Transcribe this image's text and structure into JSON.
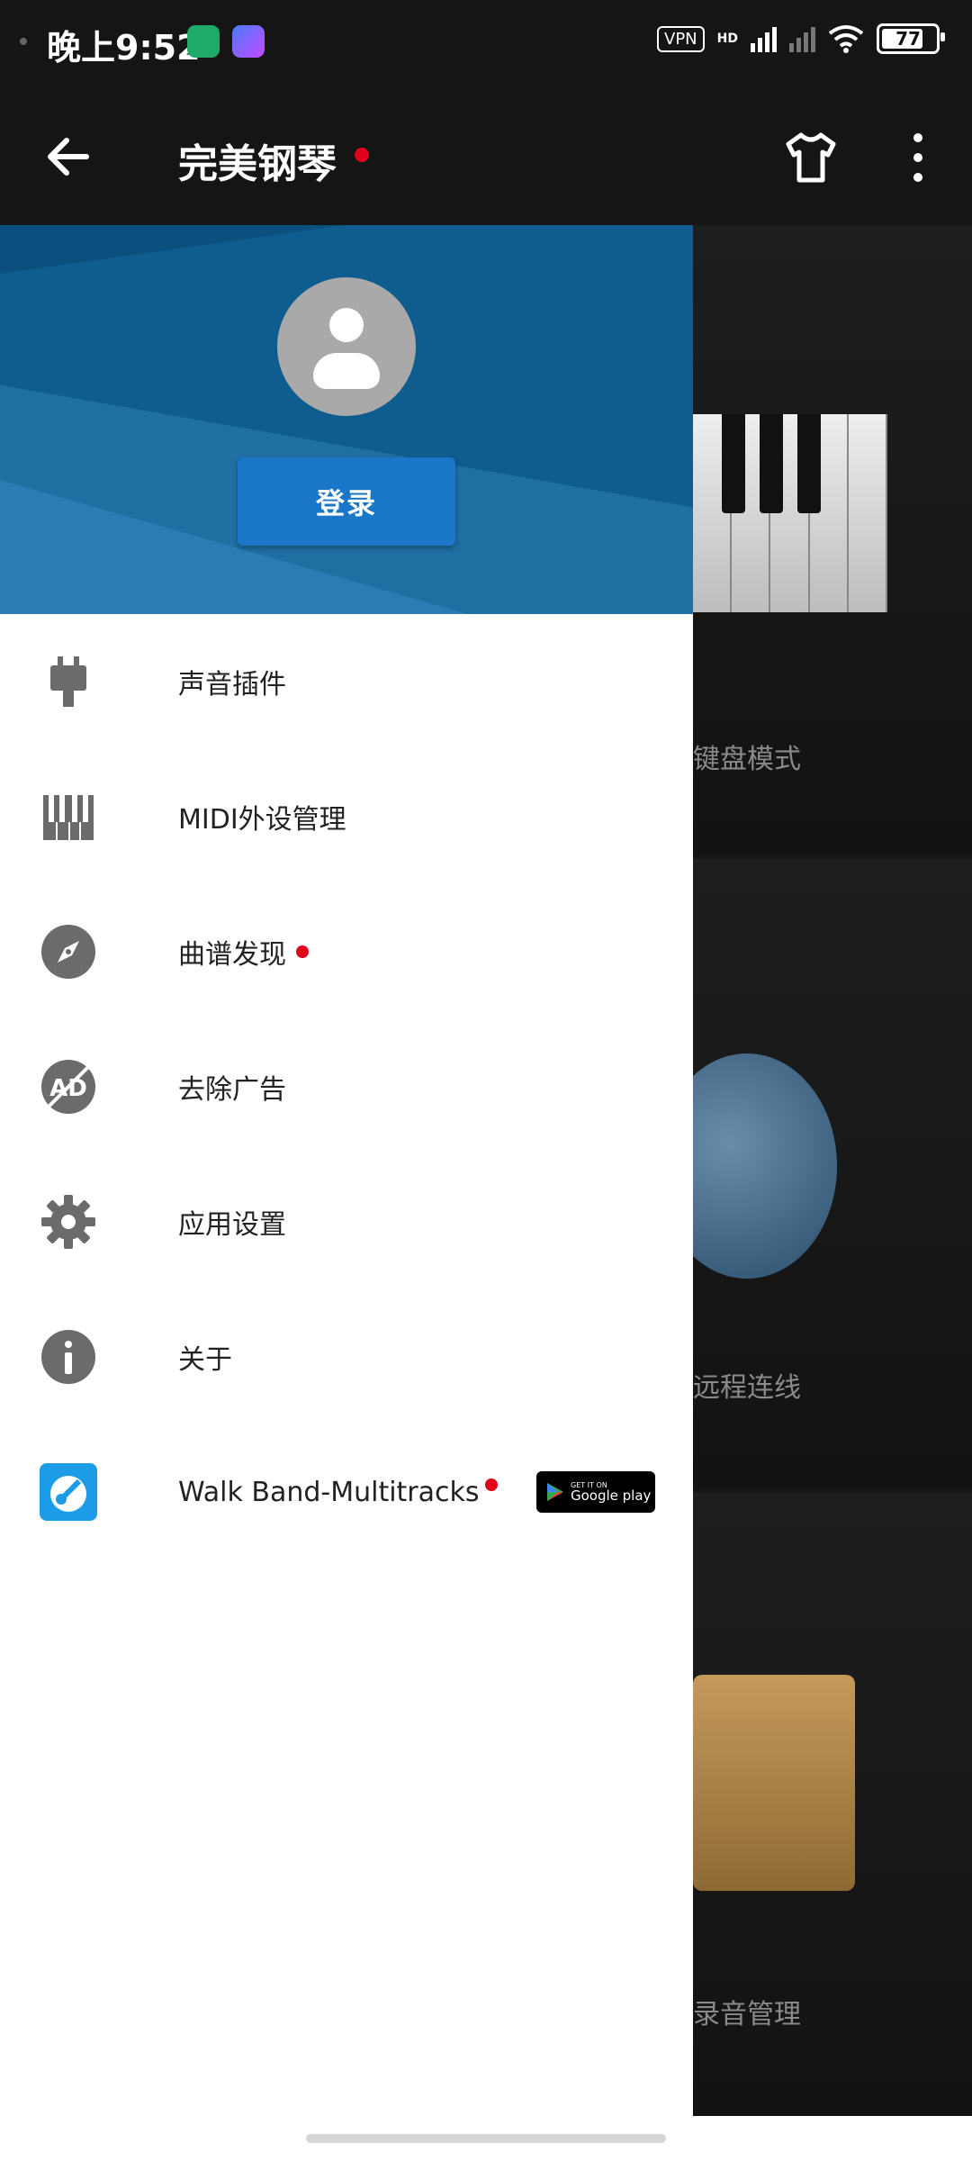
{
  "status_bar": {
    "time": "晚上9:52",
    "vpn": "VPN",
    "hd": "HD",
    "battery": "77",
    "battery_level_pct": 77
  },
  "app_bar": {
    "title": "完美钢琴"
  },
  "drawer": {
    "login_label": "登录",
    "items": [
      {
        "label": "声音插件",
        "icon": "plugin-icon"
      },
      {
        "label": "MIDI外设管理",
        "icon": "midi-keyboard-icon"
      },
      {
        "label": "曲谱发现",
        "icon": "compass-icon",
        "dot": true
      },
      {
        "label": "去除广告",
        "icon": "no-ads-icon"
      },
      {
        "label": "应用设置",
        "icon": "gear-icon"
      },
      {
        "label": "关于",
        "icon": "info-icon"
      },
      {
        "label": "Walk Band-Multitracks",
        "icon": "walk-band-app-icon",
        "dot": true,
        "badge": "Google play"
      }
    ],
    "google_play_small": "GET IT ON"
  },
  "background_cards": [
    {
      "label": "键盘模式"
    },
    {
      "label": "远程连线"
    },
    {
      "label": "录音管理"
    }
  ],
  "colors": {
    "header_blue": "#0f5c8f",
    "login_blue": "#1976c8",
    "red_dot": "#e0001a",
    "icon_gray": "#6b6b6b"
  }
}
